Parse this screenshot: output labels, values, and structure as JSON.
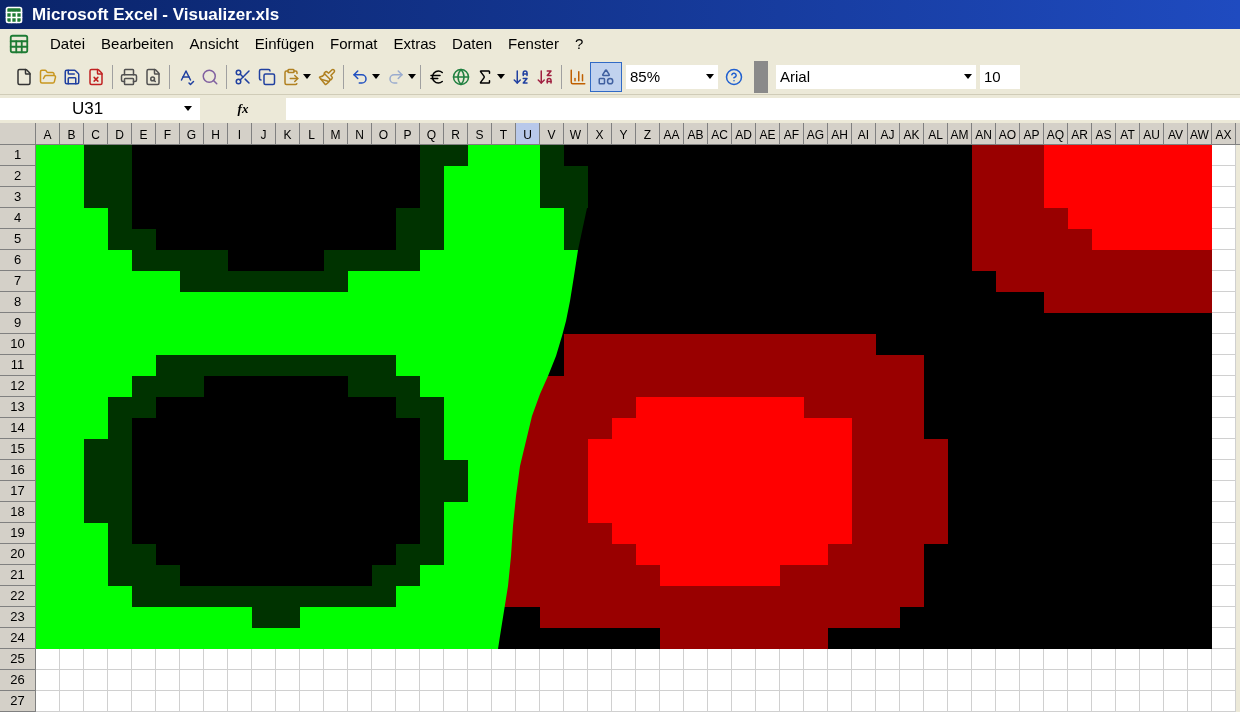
{
  "window": {
    "title": "Microsoft Excel - Visualizer.xls"
  },
  "menu": [
    "Datei",
    "Bearbeiten",
    "Ansicht",
    "Einfügen",
    "Format",
    "Extras",
    "Daten",
    "Fenster",
    "?"
  ],
  "toolbar": {
    "redo_button": {
      "disabled": true
    },
    "drawing_button": {
      "pressed": true
    },
    "zoom": "85%",
    "font": "Arial",
    "font_size": "10"
  },
  "formula_bar": {
    "name_box": "U31",
    "fx": "fx"
  },
  "columns": [
    {
      "label": "A",
      "selected": false
    },
    {
      "label": "B",
      "selected": false
    },
    {
      "label": "C",
      "selected": false
    },
    {
      "label": "D",
      "selected": false
    },
    {
      "label": "E",
      "selected": false
    },
    {
      "label": "F",
      "selected": false
    },
    {
      "label": "G",
      "selected": false
    },
    {
      "label": "H",
      "selected": false
    },
    {
      "label": "I",
      "selected": false
    },
    {
      "label": "J",
      "selected": false
    },
    {
      "label": "K",
      "selected": false
    },
    {
      "label": "L",
      "selected": false
    },
    {
      "label": "M",
      "selected": false
    },
    {
      "label": "N",
      "selected": false
    },
    {
      "label": "O",
      "selected": false
    },
    {
      "label": "P",
      "selected": false
    },
    {
      "label": "Q",
      "selected": false
    },
    {
      "label": "R",
      "selected": false
    },
    {
      "label": "S",
      "selected": false
    },
    {
      "label": "T",
      "selected": false
    },
    {
      "label": "U",
      "selected": true
    },
    {
      "label": "V",
      "selected": false
    },
    {
      "label": "W",
      "selected": false
    },
    {
      "label": "X",
      "selected": false
    },
    {
      "label": "Y",
      "selected": false
    },
    {
      "label": "Z",
      "selected": false
    },
    {
      "label": "AA",
      "selected": false
    },
    {
      "label": "AB",
      "selected": false
    },
    {
      "label": "AC",
      "selected": false
    },
    {
      "label": "AD",
      "selected": false
    },
    {
      "label": "AE",
      "selected": false
    },
    {
      "label": "AF",
      "selected": false
    },
    {
      "label": "AG",
      "selected": false
    },
    {
      "label": "AH",
      "selected": false
    },
    {
      "label": "AI",
      "selected": false
    },
    {
      "label": "AJ",
      "selected": false
    },
    {
      "label": "AK",
      "selected": false
    },
    {
      "label": "AL",
      "selected": false
    },
    {
      "label": "AM",
      "selected": false
    },
    {
      "label": "AN",
      "selected": false
    },
    {
      "label": "AO",
      "selected": false
    },
    {
      "label": "AP",
      "selected": false
    },
    {
      "label": "AQ",
      "selected": false
    },
    {
      "label": "AR",
      "selected": false
    },
    {
      "label": "AS",
      "selected": false
    },
    {
      "label": "AT",
      "selected": false
    },
    {
      "label": "AU",
      "selected": false
    },
    {
      "label": "AV",
      "selected": false
    },
    {
      "label": "AW",
      "selected": false
    },
    {
      "label": "AX",
      "selected": false
    }
  ],
  "rows": [
    "1",
    "2",
    "3",
    "4",
    "5",
    "6",
    "7",
    "8",
    "9",
    "10",
    "11",
    "12",
    "13",
    "14",
    "15",
    "16",
    "17",
    "18",
    "19",
    "20",
    "21",
    "22",
    "23",
    "24",
    "25",
    "26",
    "27"
  ]
}
